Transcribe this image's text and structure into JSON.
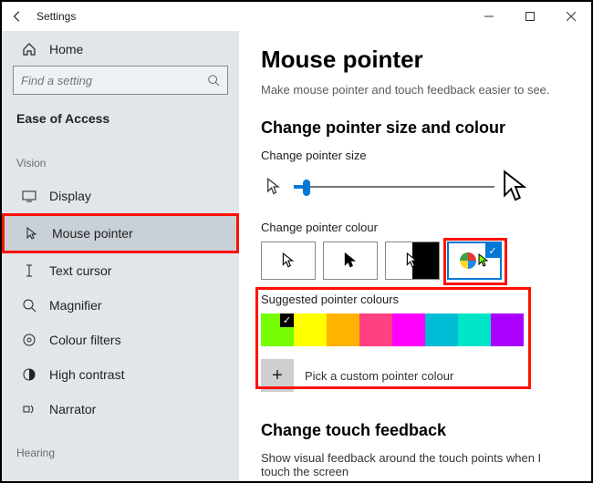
{
  "window": {
    "title": "Settings"
  },
  "sidebar": {
    "home": "Home",
    "search_placeholder": "Find a setting",
    "category": "Ease of Access",
    "group_vision": "Vision",
    "group_hearing": "Hearing",
    "items": [
      {
        "label": "Display"
      },
      {
        "label": "Mouse pointer"
      },
      {
        "label": "Text cursor"
      },
      {
        "label": "Magnifier"
      },
      {
        "label": "Colour filters"
      },
      {
        "label": "High contrast"
      },
      {
        "label": "Narrator"
      }
    ]
  },
  "main": {
    "heading": "Mouse pointer",
    "subtitle": "Make mouse pointer and touch feedback easier to see.",
    "section_size_colour": "Change pointer size and colour",
    "label_size": "Change pointer size",
    "label_colour": "Change pointer colour",
    "label_suggested": "Suggested pointer colours",
    "pick_custom": "Pick a custom pointer colour",
    "section_touch": "Change touch feedback",
    "touch_text": "Show visual feedback around the touch points when I touch the screen",
    "suggested_colours": [
      "#76ff03",
      "#ffff00",
      "#ffb300",
      "#ff4081",
      "#ff00ff",
      "#00bcd4",
      "#00e5c8",
      "#aa00ff"
    ],
    "selected_colour_index": 0,
    "selected_style_index": 3
  }
}
